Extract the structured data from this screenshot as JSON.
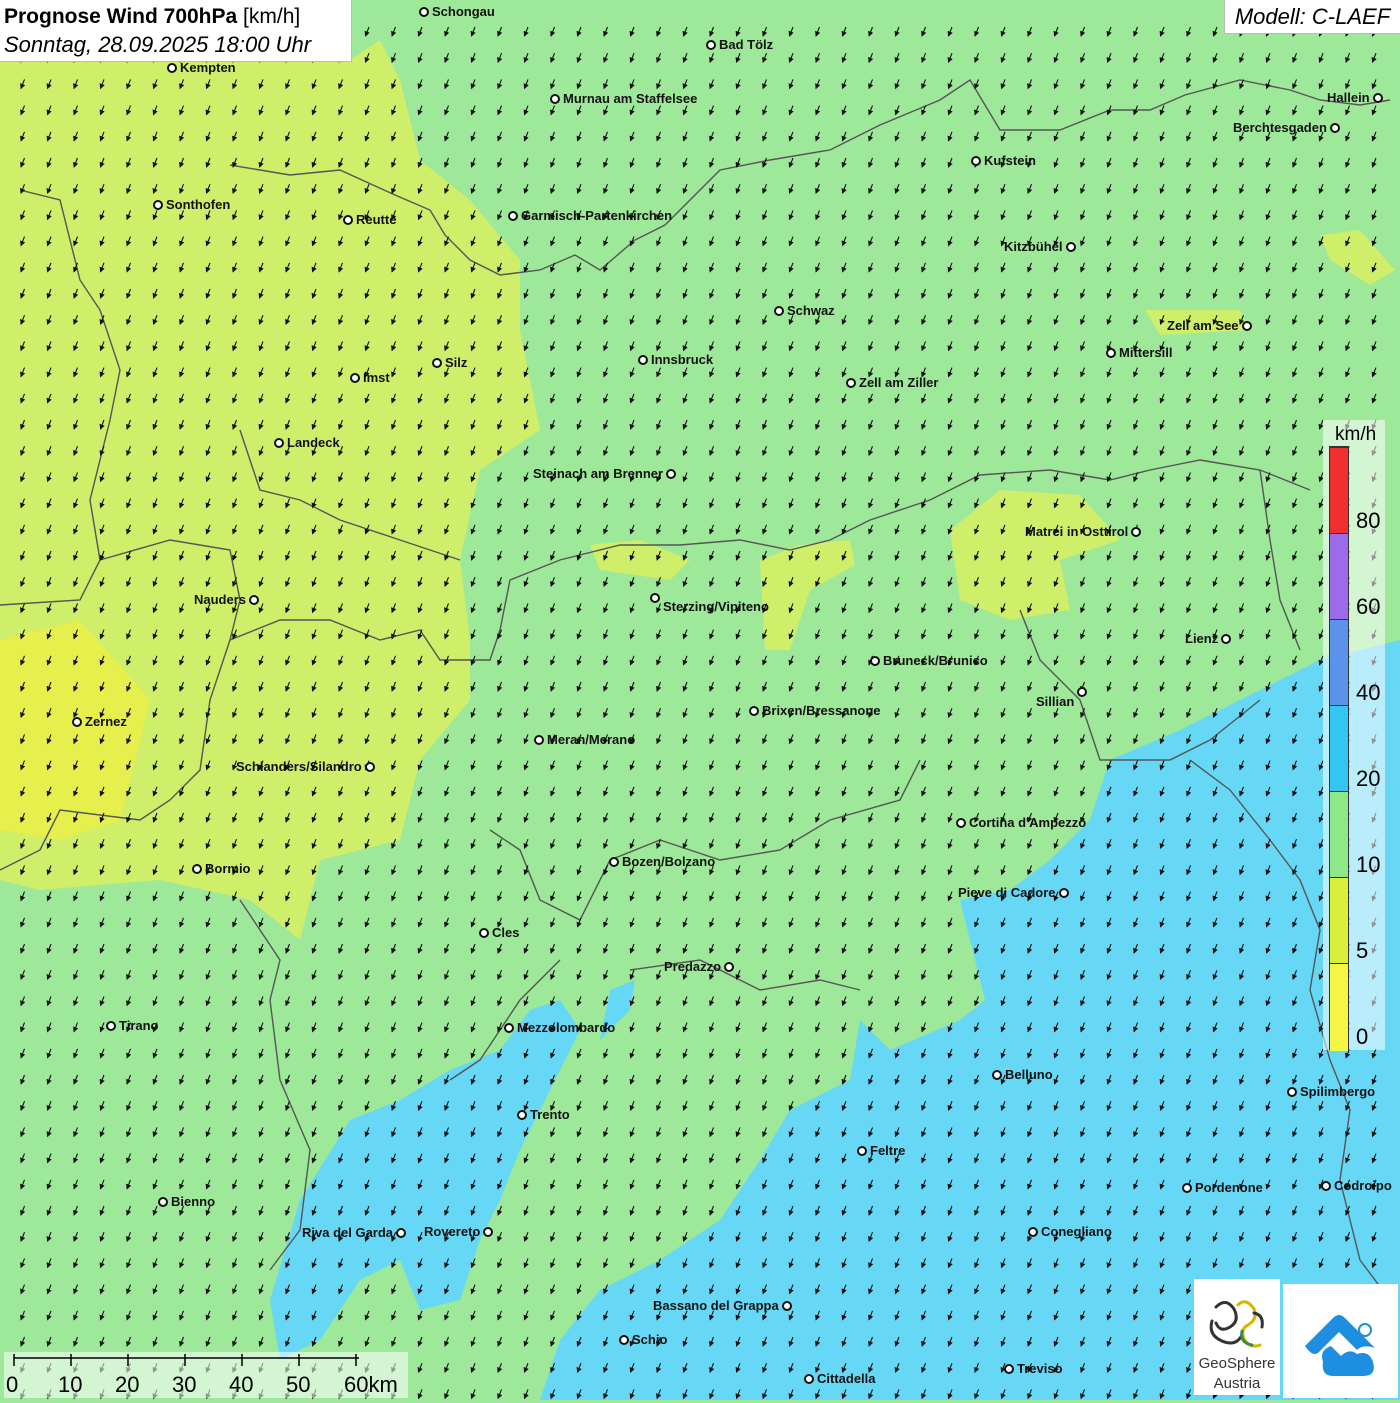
{
  "header": {
    "title_bold": "Prognose Wind 700hPa",
    "title_unit": "[km/h]",
    "date": "Sonntag, 28.09.2025 18:00 Uhr",
    "model": "Modell: C-LAEF"
  },
  "legend": {
    "unit": "km/h",
    "colors": [
      "#f5f545",
      "#d8ef3c",
      "#8ee888",
      "#33c6f2",
      "#5b92ea",
      "#9b6bea",
      "#f03030"
    ],
    "labels": [
      "0",
      "5",
      "10",
      "20",
      "40",
      "60",
      "80"
    ]
  },
  "scale": {
    "labels": [
      "0",
      "10",
      "20",
      "30",
      "40",
      "50",
      "60km"
    ]
  },
  "logo": {
    "name_bold": "GeoSphere",
    "name_sub": "Austria"
  },
  "cities": [
    {
      "name": "Schongau"
    },
    {
      "name": "Bad Tölz"
    },
    {
      "name": "Kempten"
    },
    {
      "name": "Murnau am Staffelsee"
    },
    {
      "name": "Hallein"
    },
    {
      "name": "Berchtesgaden"
    },
    {
      "name": "Kufstein"
    },
    {
      "name": "Sonthofen"
    },
    {
      "name": "Reutte"
    },
    {
      "name": "Garmisch-Partenkirchen"
    },
    {
      "name": "Kitzbühel"
    },
    {
      "name": "Schwaz"
    },
    {
      "name": "Zell am See"
    },
    {
      "name": "Mittersill"
    },
    {
      "name": "Innsbruck"
    },
    {
      "name": "Silz"
    },
    {
      "name": "Imst"
    },
    {
      "name": "Zell am Ziller"
    },
    {
      "name": "Landeck"
    },
    {
      "name": "Steinach am Brenner"
    },
    {
      "name": "Matrei in Osttirol"
    },
    {
      "name": "Nauders"
    },
    {
      "name": "Sterzing/Vipiteno"
    },
    {
      "name": "Lienz"
    },
    {
      "name": "Bruneck/Brunico"
    },
    {
      "name": "Sillian"
    },
    {
      "name": "Zernez"
    },
    {
      "name": "Brixen/Bressanone"
    },
    {
      "name": "Meran/Merano"
    },
    {
      "name": "Schlanders/Silandro"
    },
    {
      "name": "Cortina d'Ampezzo"
    },
    {
      "name": "Bozen/Bolzano"
    },
    {
      "name": "Bormio"
    },
    {
      "name": "Pieve di Cadore"
    },
    {
      "name": "Cles"
    },
    {
      "name": "Predazzo"
    },
    {
      "name": "Tirano"
    },
    {
      "name": "Mezzolombardo"
    },
    {
      "name": "Belluno"
    },
    {
      "name": "Spilimbergo"
    },
    {
      "name": "Trento"
    },
    {
      "name": "Feltre"
    },
    {
      "name": "Bienno"
    },
    {
      "name": "Pordenone"
    },
    {
      "name": "Codroipo"
    },
    {
      "name": "Riva del Garda"
    },
    {
      "name": "Rovereto"
    },
    {
      "name": "Conegliano"
    },
    {
      "name": "Bassano del Grappa"
    },
    {
      "name": "Schio"
    },
    {
      "name": "Treviso"
    },
    {
      "name": "Cittadella"
    }
  ]
}
